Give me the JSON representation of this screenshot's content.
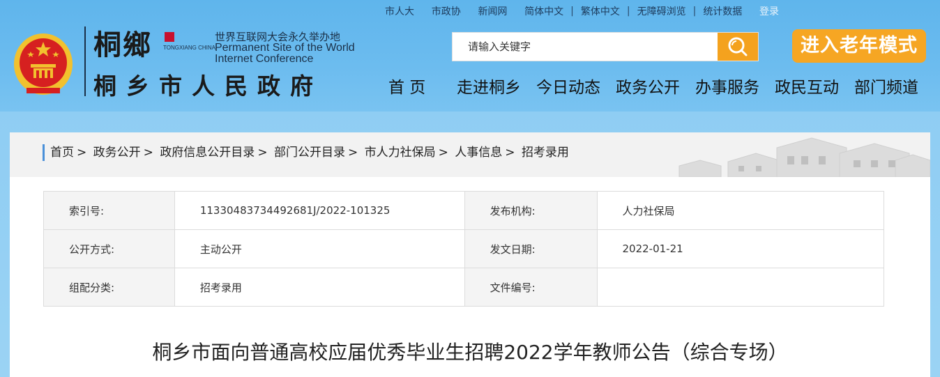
{
  "top_links": [
    "市人大",
    "市政协",
    "新闻网",
    "简体中文",
    "繁体中文",
    "无障碍浏览",
    "统计数据",
    "登录"
  ],
  "logo": {
    "calligraphy": "桐鄉",
    "brand_small": "TONGXIANG CHINA",
    "wic_cn": "世界互联网大会永久举办地",
    "wic_en_1": "Permanent Site of the World",
    "wic_en_2": "Internet Conference",
    "site_name": "桐乡市人民政府"
  },
  "search": {
    "placeholder": "请输入关键字"
  },
  "elder_mode": "进入老年模式",
  "main_nav": [
    "首 页",
    "走进桐乡",
    "今日动态",
    "政务公开",
    "办事服务",
    "政民互动",
    "部门频道"
  ],
  "breadcrumb": [
    "首页",
    "政务公开",
    "政府信息公开目录",
    "部门公开目录",
    "市人力社保局",
    "人事信息",
    "招考录用"
  ],
  "meta": {
    "index_no_label": "索引号:",
    "index_no": "11330483734492681J/2022-101325",
    "issuer_label": "发布机构:",
    "issuer": "人力社保局",
    "open_mode_label": "公开方式:",
    "open_mode": "主动公开",
    "date_label": "发文日期:",
    "date": "2022-01-21",
    "category_label": "组配分类:",
    "category": "招考录用",
    "doc_no_label": "文件编号:",
    "doc_no": ""
  },
  "article_title": "桐乡市面向普通高校应届优秀毕业生招聘2022学年教师公告（综合专场）",
  "colors": {
    "accent_orange": "#f6a623",
    "breadcrumb_bar": "#4a90d9",
    "emblem_red": "#d62020",
    "emblem_gold": "#f2c12e"
  }
}
